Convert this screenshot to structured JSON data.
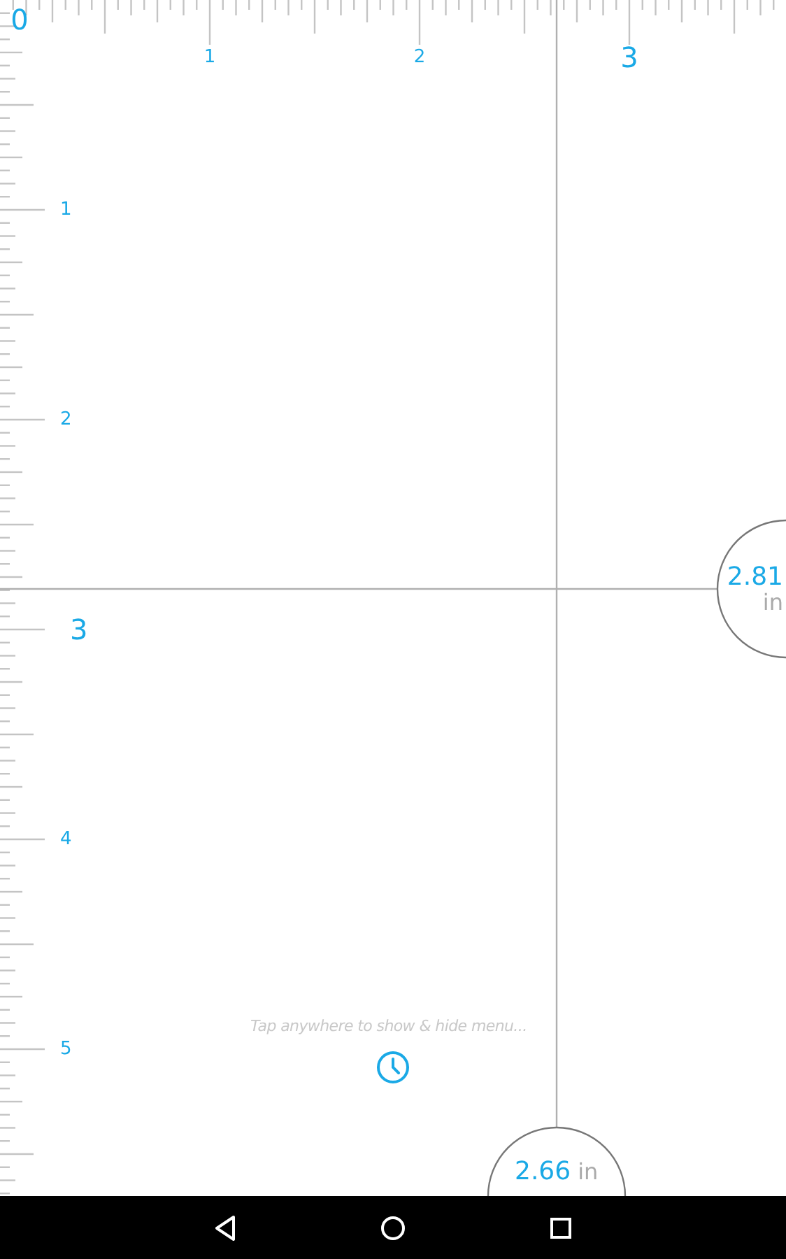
{
  "top_ruler": {
    "labels": [
      {
        "text": "0",
        "highlighted": true
      },
      {
        "text": "1",
        "highlighted": false
      },
      {
        "text": "2",
        "highlighted": false
      },
      {
        "text": "3",
        "highlighted": true
      }
    ]
  },
  "left_ruler": {
    "labels": [
      {
        "text": "1",
        "highlighted": false
      },
      {
        "text": "2",
        "highlighted": false
      },
      {
        "text": "3",
        "highlighted": true
      },
      {
        "text": "4",
        "highlighted": false
      },
      {
        "text": "5",
        "highlighted": false
      }
    ]
  },
  "readouts": [
    {
      "kind": "vertical",
      "value": "2.81",
      "unit": "in"
    },
    {
      "kind": "horizontal",
      "value": "2.66",
      "unit": "in"
    }
  ],
  "hint": "Tap anywhere to show & hide menu...",
  "nav_bar": {
    "buttons": [
      {
        "kind": "back"
      },
      {
        "kind": "home"
      },
      {
        "kind": "recents"
      }
    ]
  }
}
